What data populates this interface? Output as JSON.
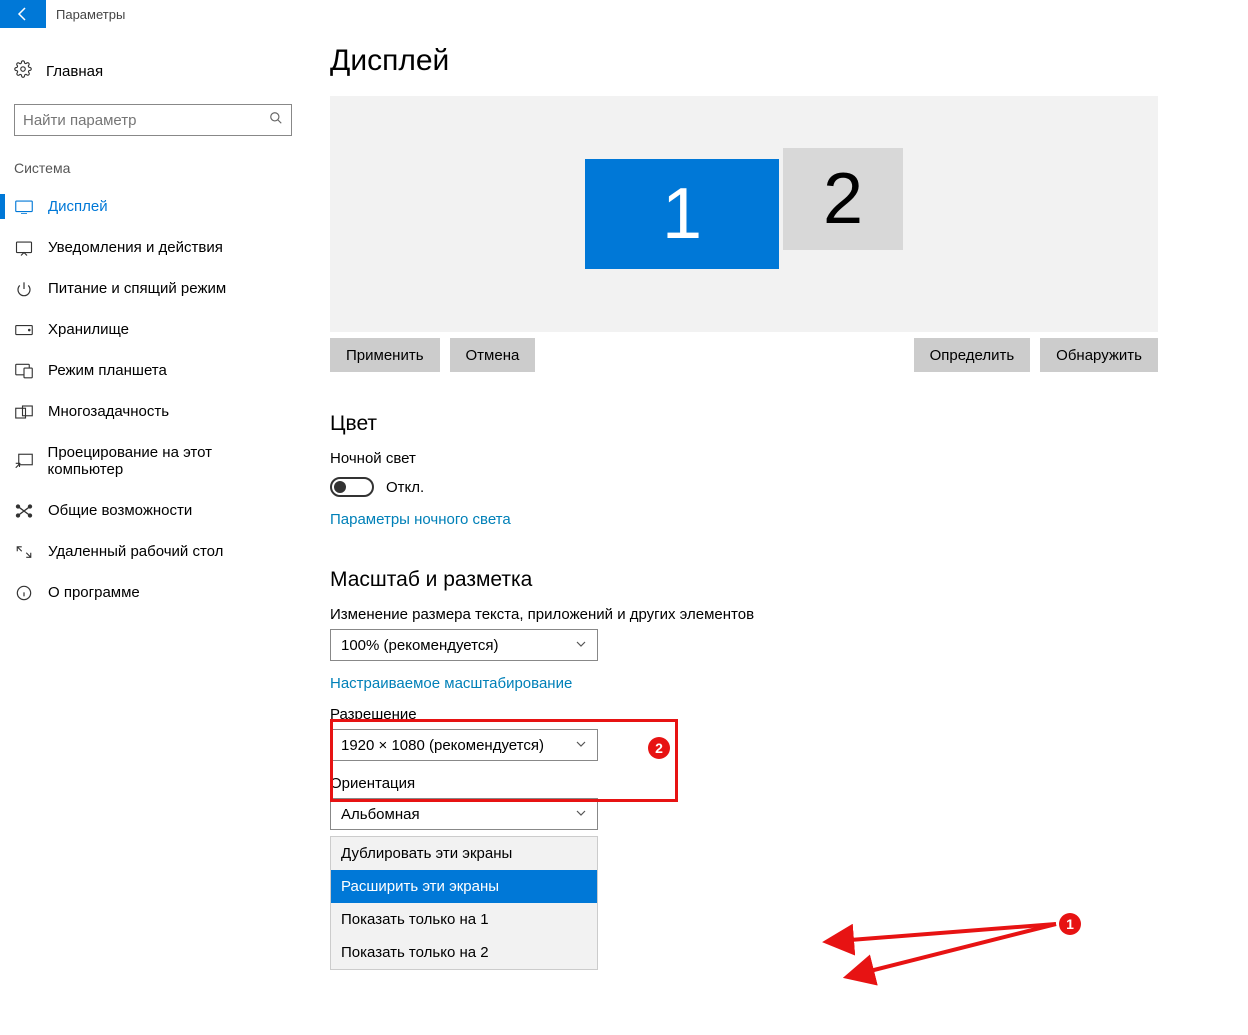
{
  "titlebar": {
    "label": "Параметры"
  },
  "sidebar": {
    "home_label": "Главная",
    "search_placeholder": "Найти параметр",
    "group_label": "Система",
    "items": [
      {
        "label": "Дисплей"
      },
      {
        "label": "Уведомления и действия"
      },
      {
        "label": "Питание и спящий режим"
      },
      {
        "label": "Хранилище"
      },
      {
        "label": "Режим планшета"
      },
      {
        "label": "Многозадачность"
      },
      {
        "label": "Проецирование на этот компьютер"
      },
      {
        "label": "Общие возможности"
      },
      {
        "label": "Удаленный рабочий стол"
      },
      {
        "label": "О программе"
      }
    ]
  },
  "main": {
    "page_title": "Дисплей",
    "monitor1": "1",
    "monitor2": "2",
    "apply_btn": "Применить",
    "cancel_btn": "Отмена",
    "identify_btn": "Определить",
    "detect_btn": "Обнаружить",
    "color_section": "Цвет",
    "night_light_label": "Ночной свет",
    "toggle_off": "Откл.",
    "night_light_settings_link": "Параметры ночного света",
    "scale_section": "Масштаб и разметка",
    "scale_label": "Изменение размера текста, приложений и других элементов",
    "scale_value": "100% (рекомендуется)",
    "custom_scale_link": "Настраиваемое масштабирование",
    "resolution_label": "Разрешение",
    "resolution_value": "1920 × 1080 (рекомендуется)",
    "orientation_label": "Ориентация",
    "orientation_value": "Альбомная",
    "multi_options": [
      "Дублировать эти экраны",
      "Расширить эти экраны",
      "Показать только на 1",
      "Показать только на 2"
    ]
  },
  "annotations": {
    "badge1": "1",
    "badge2": "2"
  }
}
